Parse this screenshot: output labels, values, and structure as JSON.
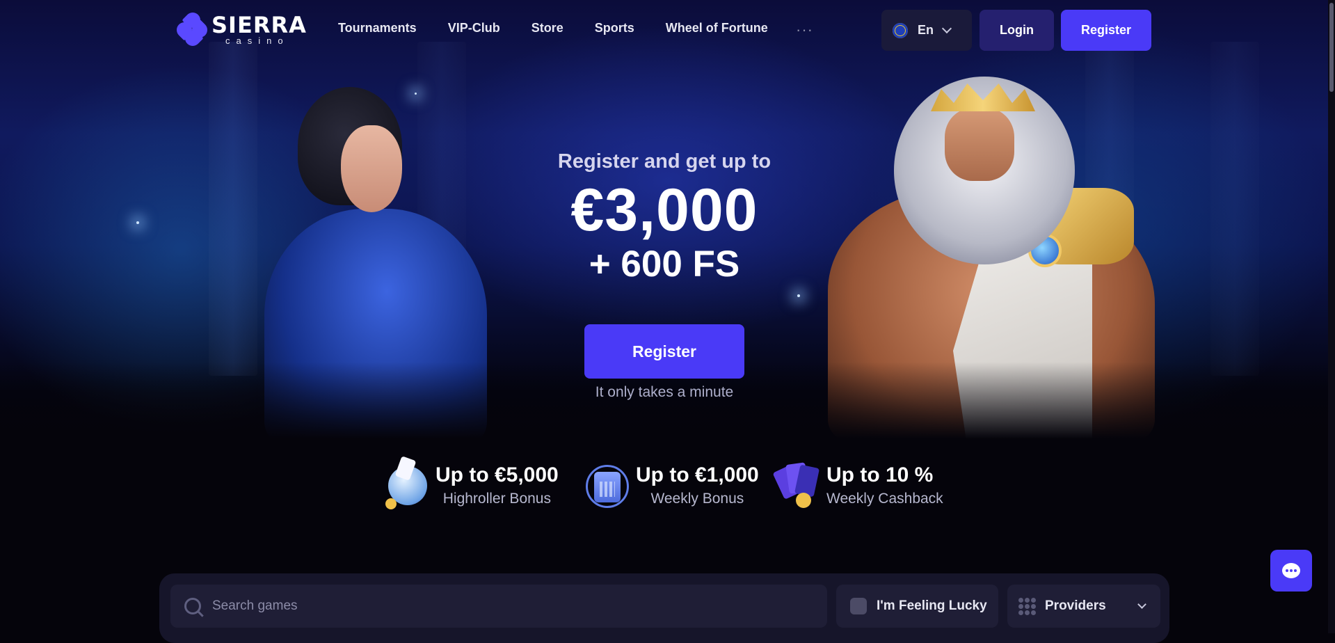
{
  "header": {
    "logo": {
      "name": "SIERRA",
      "sub": "casino"
    },
    "nav": [
      {
        "label": "Tournaments"
      },
      {
        "label": "VIP-Club"
      },
      {
        "label": "Store"
      },
      {
        "label": "Sports"
      },
      {
        "label": "Wheel of Fortune"
      }
    ],
    "more_label": "···",
    "language": {
      "label": "En",
      "icon": "eu-flag-icon"
    },
    "login_label": "Login",
    "register_label": "Register"
  },
  "hero": {
    "lead": "Register and get up to",
    "amount": "€3,000",
    "free_spins": "+ 600 FS",
    "cta_label": "Register",
    "note": "It only takes a minute"
  },
  "bonuses": [
    {
      "title": "Up to €5,000",
      "subtitle": "Highroller Bonus",
      "icon": "crystal-ball-icon"
    },
    {
      "title": "Up to €1,000",
      "subtitle": "Weekly Bonus",
      "icon": "calendar-icon"
    },
    {
      "title": "Up to 10 %",
      "subtitle": "Weekly Cashback",
      "icon": "cards-icon"
    }
  ],
  "search": {
    "placeholder": "Search games",
    "lucky_label": "I'm Feeling Lucky",
    "providers_label": "Providers"
  },
  "colors": {
    "accent": "#4a3af7",
    "background": "#05040b",
    "panel": "#1f1e36"
  }
}
